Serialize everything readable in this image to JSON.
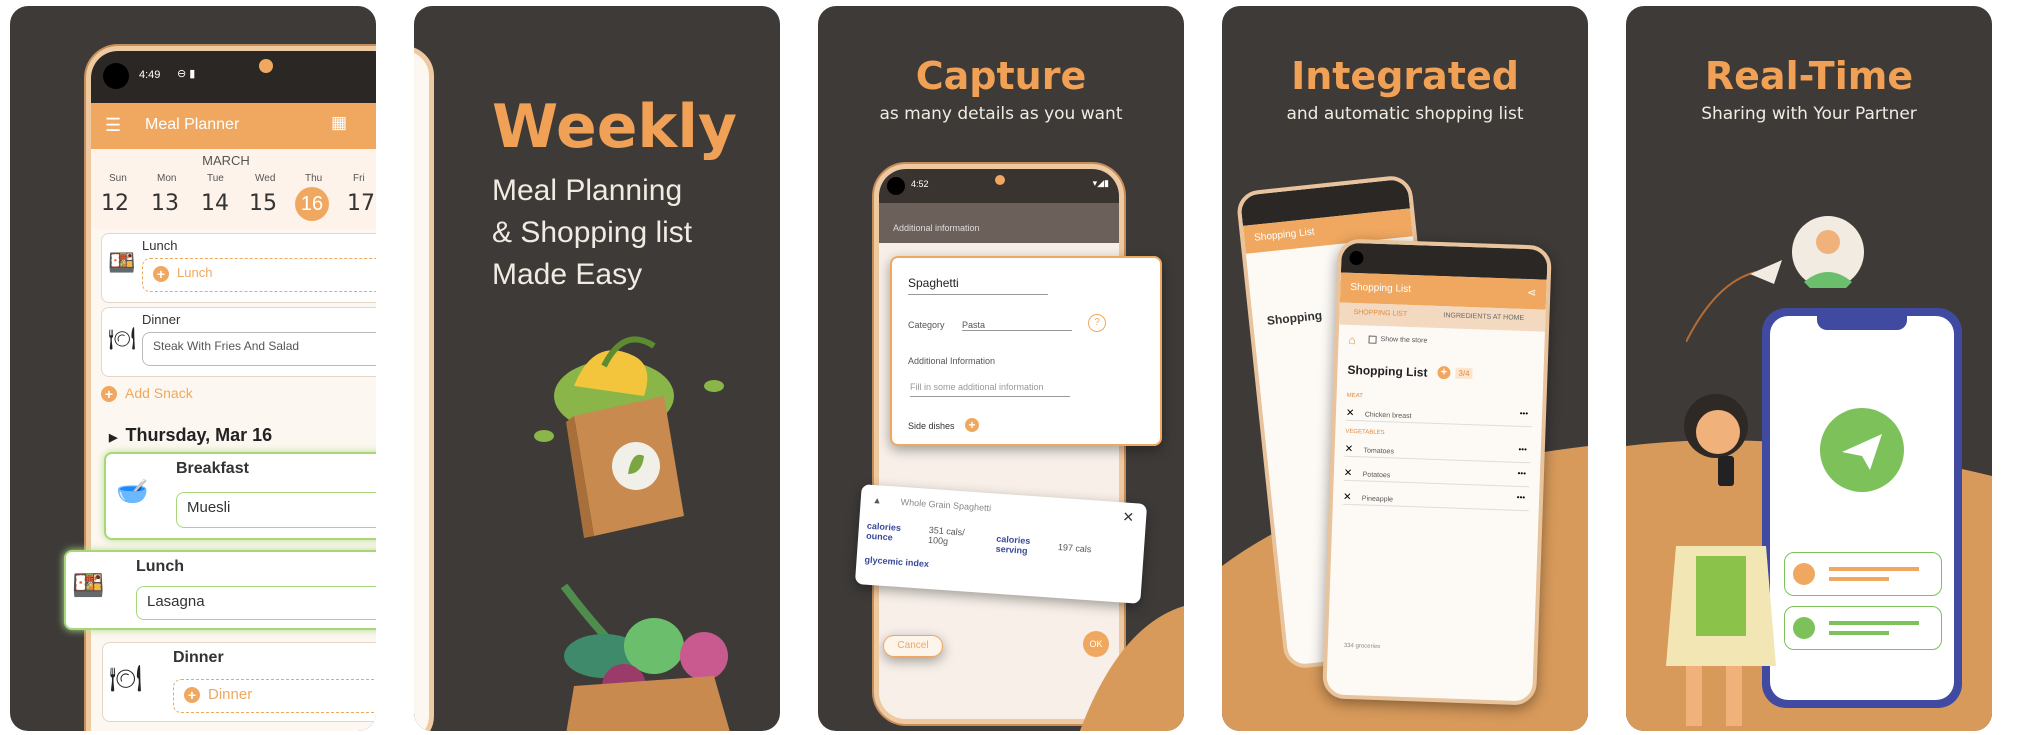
{
  "colors": {
    "panel_bg": "#3d3a38",
    "accent_orange": "#f0a155",
    "appbar": "#f0a860",
    "highlight_green": "#a8d77a"
  },
  "panel1": {
    "status_time": "4:49",
    "appbar_title": "Meal Planner",
    "month": "MARCH",
    "days": [
      {
        "name": "Sun",
        "num": "12"
      },
      {
        "name": "Mon",
        "num": "13"
      },
      {
        "name": "Tue",
        "num": "14"
      },
      {
        "name": "Wed",
        "num": "15"
      },
      {
        "name": "Thu",
        "num": "16"
      },
      {
        "name": "Fri",
        "num": "17"
      }
    ],
    "selected_day": "16",
    "lunch_label": "Lunch",
    "lunch_placeholder": "Lunch",
    "dinner_label": "Dinner",
    "dinner_value": "Steak With Fries And Salad",
    "add_snack": "Add Snack",
    "date_header": "Thursday, Mar 16",
    "breakfast_label": "Breakfast",
    "breakfast_value": "Muesli",
    "lunch2_label": "Lunch",
    "lunch2_value": "Lasagna",
    "dinner2_label": "Dinner",
    "dinner2_placeholder": "Dinner"
  },
  "panel2": {
    "headline": "Weekly",
    "line1": "Meal Planning",
    "line2": "& Shopping list",
    "line3": "Made Easy"
  },
  "panel3": {
    "headline": "Capture",
    "subline": "as many details as you want",
    "status_time": "4:52",
    "additional_info_header": "Additional information",
    "dish_name": "Spaghetti",
    "category_label": "Category",
    "category_value": "Pasta",
    "additional_info_label": "Additional Information",
    "additional_info_placeholder": "Fill in some additional information",
    "side_dishes_label": "Side dishes",
    "nutrition_item": "Whole Grain Spaghetti",
    "nutr_label1": "calories ounce",
    "nutr_value1": "351 cals/ 100g",
    "nutr_label2": "calories serving",
    "nutr_value2": "197 cals",
    "nutr_label3": "glycemic index",
    "cancel_label": "Cancel",
    "ok_label": "OK"
  },
  "panel4": {
    "headline": "Integrated",
    "subline": "and automatic shopping list",
    "back_title": "Shopping List",
    "front_title": "Shopping List",
    "tab1": "SHOPPING LIST",
    "tab2": "INGREDIENTS AT HOME",
    "show_store": "Show the store",
    "list_heading": "Shopping List",
    "badge": "3/4",
    "section_meat": "MEAT",
    "item_chicken": "Chicken breast",
    "section_veg": "VEGETABLES",
    "item_tomatoes": "Tomatoes",
    "item_potatoes": "Potatoes",
    "item_pineapple": "Pineapple",
    "footer": "334 groceries"
  },
  "panel5": {
    "headline": "Real-Time",
    "subline": "Sharing with Your Partner"
  }
}
